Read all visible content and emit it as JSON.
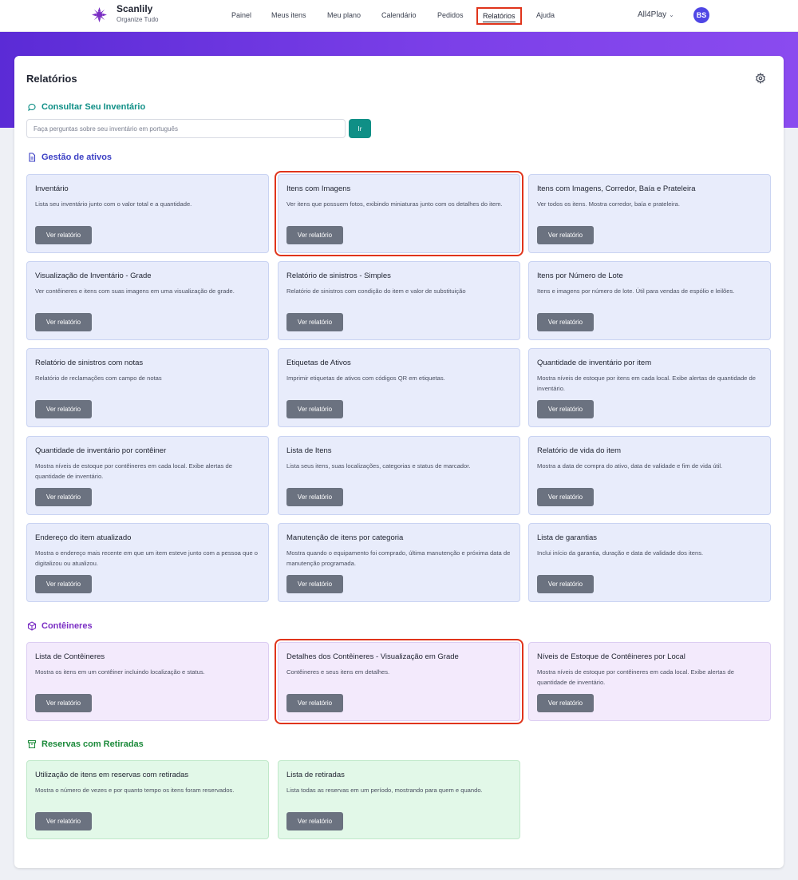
{
  "brand": {
    "name": "Scanlily",
    "tagline": "Organize Tudo"
  },
  "nav": {
    "items": [
      "Painel",
      "Meus itens",
      "Meu plano",
      "Calendário",
      "Pedidos",
      "Relatórios",
      "Ajuda"
    ],
    "active": "Relatórios",
    "account": "All4Play",
    "avatar": "BS"
  },
  "page": {
    "title": "Relatórios",
    "search": {
      "heading": "Consultar Seu Inventário",
      "placeholder": "Faça perguntas sobre seu inventário em português",
      "button": "Ir"
    }
  },
  "button_label": "Ver relatório",
  "sections": [
    {
      "heading": "Gestão de ativos",
      "color": "#3b3fc4",
      "icon": "document-icon",
      "cards": [
        {
          "title": "Inventário",
          "desc": "Lista seu inventário junto com o valor total e a quantidade."
        },
        {
          "title": "Itens com Imagens",
          "desc": "Ver itens que possuem fotos, exibindo miniaturas junto com os detalhes do item."
        },
        {
          "title": "Itens com Imagens, Corredor, Baía e Prateleira",
          "desc": "Ver todos os itens. Mostra corredor, baía e prateleira."
        },
        {
          "title": "Visualização de Inventário - Grade",
          "desc": "Ver contêineres e itens com suas imagens em uma visualização de grade."
        },
        {
          "title": "Relatório de sinistros - Simples",
          "desc": "Relatório de sinistros com condição do item e valor de substituição"
        },
        {
          "title": "Itens por Número de Lote",
          "desc": "Itens e imagens por número de lote. Útil para vendas de espólio e leilões."
        },
        {
          "title": "Relatório de sinistros com notas",
          "desc": "Relatório de reclamações com campo de notas"
        },
        {
          "title": "Etiquetas de Ativos",
          "desc": "Imprimir etiquetas de ativos com códigos QR em etiquetas."
        },
        {
          "title": "Quantidade de inventário por item",
          "desc": "Mostra níveis de estoque por itens em cada local. Exibe alertas de quantidade de inventário."
        },
        {
          "title": "Quantidade de inventário por contêiner",
          "desc": "Mostra níveis de estoque por contêineres em cada local. Exibe alertas de quantidade de inventário."
        },
        {
          "title": "Lista de Itens",
          "desc": "Lista seus itens, suas localizações, categorias e status de marcador."
        },
        {
          "title": "Relatório de vida do item",
          "desc": "Mostra a data de compra do ativo, data de validade e fim de vida útil."
        },
        {
          "title": "Endereço do item atualizado",
          "desc": "Mostra o endereço mais recente em que um item esteve junto com a pessoa que o digitalizou ou atualizou."
        },
        {
          "title": "Manutenção de itens por categoria",
          "desc": "Mostra quando o equipamento foi comprado, última manutenção e próxima data de manutenção programada."
        },
        {
          "title": "Lista de garantias",
          "desc": "Inclui início da garantia, duração e data de validade dos itens."
        }
      ]
    },
    {
      "heading": "Contêineres",
      "color": "#7b2fc4",
      "icon": "box-icon",
      "cards": [
        {
          "title": "Lista de Contêineres",
          "desc": "Mostra os itens em um contêiner incluindo localização e status."
        },
        {
          "title": "Detalhes dos Contêineres - Visualização em Grade",
          "desc": "Contêineres e seus itens em detalhes."
        },
        {
          "title": "Níveis de Estoque de Contêineres por Local",
          "desc": "Mostra níveis de estoque por contêineres em cada local. Exibe alertas de quantidade de inventário."
        }
      ]
    },
    {
      "heading": "Reservas com Retiradas",
      "color": "#1b8a3a",
      "icon": "archive-icon",
      "cards": [
        {
          "title": "Utilização de itens em reservas com retiradas",
          "desc": "Mostra o número de vezes e por quanto tempo os itens foram reservados."
        },
        {
          "title": "Lista de retiradas",
          "desc": "Lista todas as reservas em um período, mostrando para quem e quando."
        }
      ]
    }
  ],
  "colors": {
    "brand_purple": "#7b3fe8",
    "teal": "#0f8f86",
    "highlight": "#e0341b"
  }
}
